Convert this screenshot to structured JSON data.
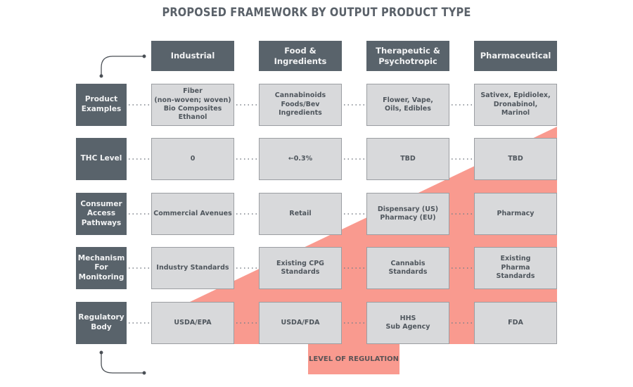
{
  "title": "PROPOSED FRAMEWORK BY OUTPUT PRODUCT TYPE",
  "columns": [
    "Industrial",
    "Food &\nIngredients",
    "Therapeutic &\nPsychotropic",
    "Pharmaceutical"
  ],
  "rows": [
    {
      "label": "Product\nExamples",
      "cells": [
        "Fiber\n(non-woven; woven)\nBio Composites\nEthanol",
        "Cannabinoids\nFoods/Bev\nIngredients",
        "Flower, Vape,\nOils, Edibles",
        "Sativex, Epidiolex,\nDronabinol,\nMarinol"
      ]
    },
    {
      "label": "THC Level",
      "cells": [
        "0",
        "←0.3%",
        "TBD",
        "TBD"
      ]
    },
    {
      "label": "Consumer\nAccess\nPathways",
      "cells": [
        "Commercial Avenues",
        "Retail",
        "Dispensary (US)\nPharmacy (EU)",
        "Pharmacy"
      ]
    },
    {
      "label": "Mechanism\nFor\nMonitoring",
      "cells": [
        "Industry Standards",
        "Existing CPG\nStandards",
        "Cannabis\nStandards",
        "Existing\nPharma\nStandards"
      ]
    },
    {
      "label": "Regulatory\nBody",
      "cells": [
        "USDA/EPA",
        "USDA/FDA",
        "HHS\nSub Agency",
        "FDA"
      ]
    }
  ],
  "regulation_label": "LEVEL OF REGULATION",
  "colors": {
    "dark_box": "#59636b",
    "cell_fill": "#d8d9db",
    "regulation_fill": "#f99a8f"
  }
}
